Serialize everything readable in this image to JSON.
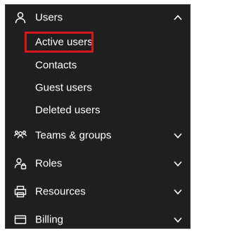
{
  "nav": {
    "users": {
      "label": "Users",
      "icon": "person-icon",
      "expanded": true,
      "children": [
        {
          "label": "Active users"
        },
        {
          "label": "Contacts"
        },
        {
          "label": "Guest users"
        },
        {
          "label": "Deleted users"
        }
      ]
    },
    "teams_groups": {
      "label": "Teams & groups",
      "icon": "people-group-icon"
    },
    "roles": {
      "label": "Roles",
      "icon": "person-key-icon"
    },
    "resources": {
      "label": "Resources",
      "icon": "printer-icon"
    },
    "billing": {
      "label": "Billing",
      "icon": "credit-card-icon"
    }
  },
  "colors": {
    "panel_bg": "#1f1f1f",
    "text": "#ffffff",
    "highlight_border": "#d9161c"
  }
}
